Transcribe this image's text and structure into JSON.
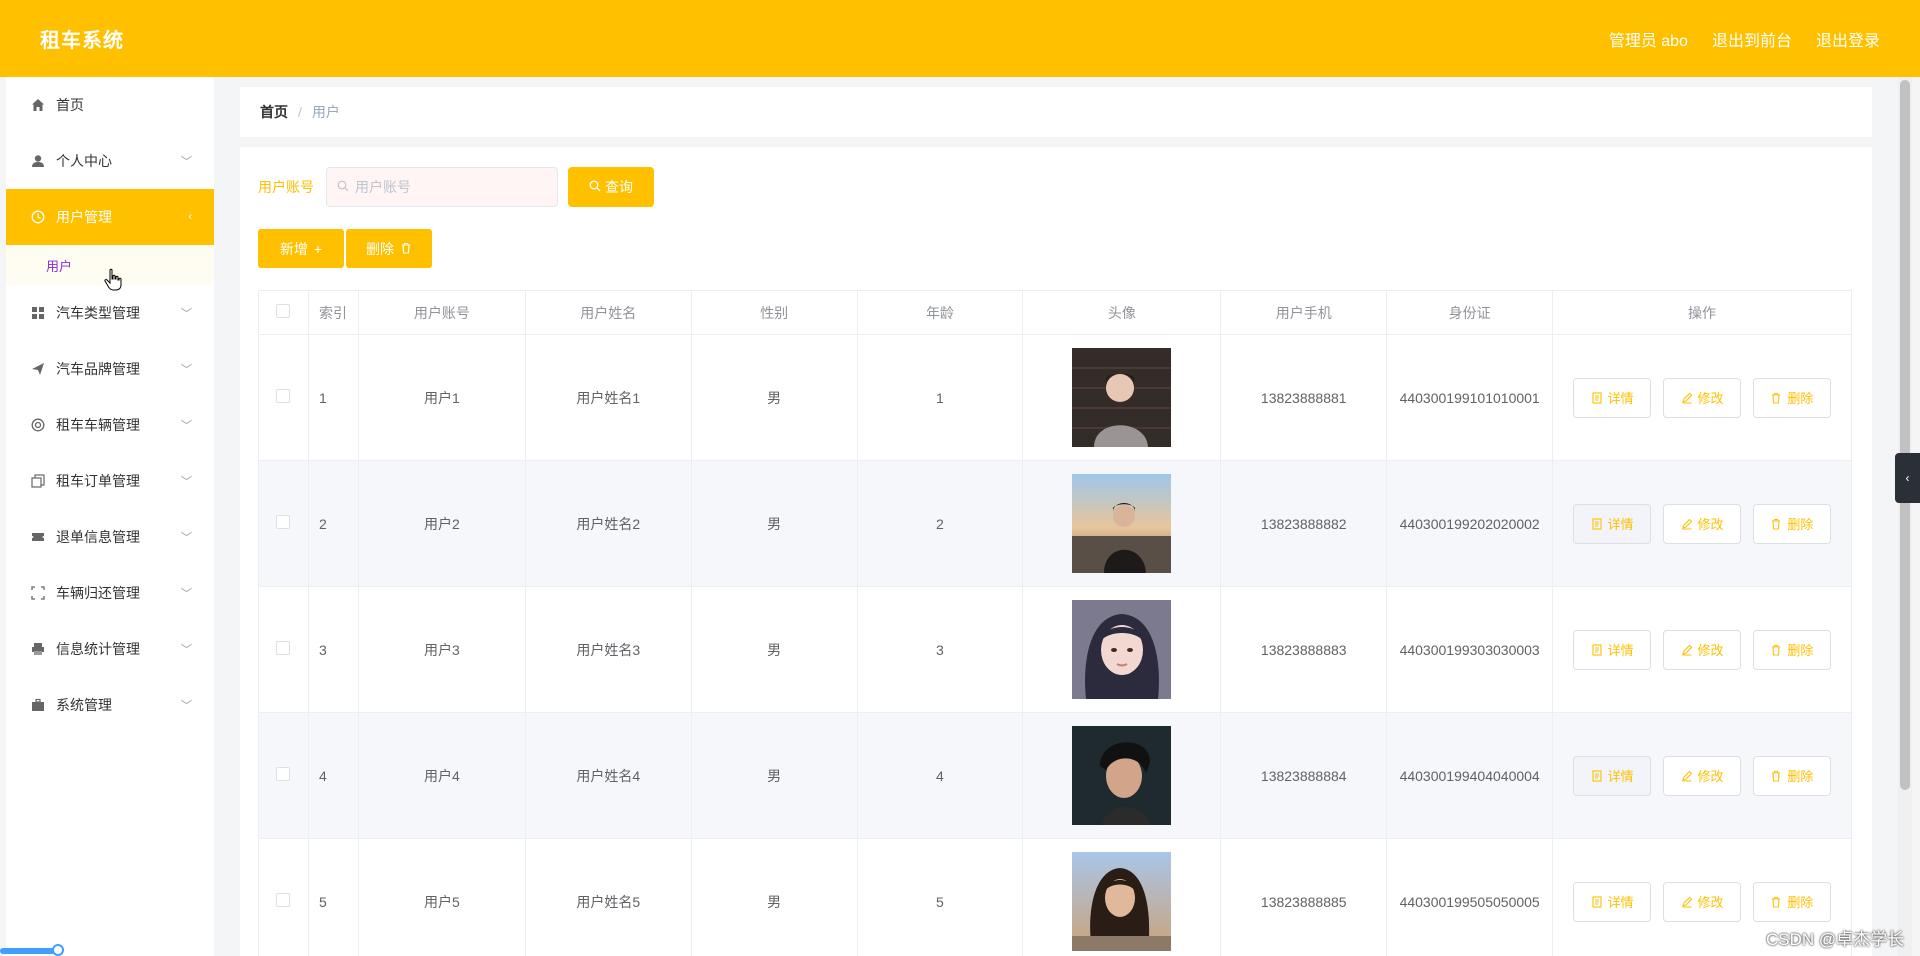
{
  "header": {
    "brand": "租车系统",
    "admin_label": "管理员 abo",
    "to_front": "退出到前台",
    "logout": "退出登录"
  },
  "sidebar": {
    "items": [
      {
        "label": "首页",
        "icon": "home-icon",
        "has_chevron": false
      },
      {
        "label": "个人中心",
        "icon": "user-icon",
        "has_chevron": true
      },
      {
        "label": "用户管理",
        "icon": "clock-icon",
        "has_chevron": true,
        "active": true
      },
      {
        "label": "汽车类型管理",
        "icon": "grid-icon",
        "has_chevron": true
      },
      {
        "label": "汽车品牌管理",
        "icon": "send-icon",
        "has_chevron": true
      },
      {
        "label": "租车车辆管理",
        "icon": "lifebuoy-icon",
        "has_chevron": true
      },
      {
        "label": "租车订单管理",
        "icon": "copy-icon",
        "has_chevron": true
      },
      {
        "label": "退单信息管理",
        "icon": "ticket-icon",
        "has_chevron": true
      },
      {
        "label": "车辆归还管理",
        "icon": "fullscreen-icon",
        "has_chevron": true
      },
      {
        "label": "信息统计管理",
        "icon": "printer-icon",
        "has_chevron": true
      },
      {
        "label": "系统管理",
        "icon": "briefcase-icon",
        "has_chevron": true
      }
    ],
    "submenu": {
      "label": "用户"
    }
  },
  "breadcrumb": {
    "home": "首页",
    "separator": "/",
    "current": "用户"
  },
  "search": {
    "label": "用户账号",
    "placeholder": "用户账号",
    "value": "",
    "query_button": "查询"
  },
  "actions": {
    "add": "新增",
    "delete": "删除"
  },
  "table": {
    "columns": [
      "索引",
      "用户账号",
      "用户姓名",
      "性别",
      "年龄",
      "头像",
      "用户手机",
      "身份证",
      "操作"
    ],
    "op_labels": {
      "detail": "详情",
      "edit": "修改",
      "delete": "删除"
    },
    "rows": [
      {
        "index": "1",
        "account": "用户1",
        "name": "用户姓名1",
        "gender": "男",
        "age": "1",
        "phone": "13823888881",
        "idcard": "440300199101010001"
      },
      {
        "index": "2",
        "account": "用户2",
        "name": "用户姓名2",
        "gender": "男",
        "age": "2",
        "phone": "13823888882",
        "idcard": "440300199202020002"
      },
      {
        "index": "3",
        "account": "用户3",
        "name": "用户姓名3",
        "gender": "男",
        "age": "3",
        "phone": "13823888883",
        "idcard": "440300199303030003"
      },
      {
        "index": "4",
        "account": "用户4",
        "name": "用户姓名4",
        "gender": "男",
        "age": "4",
        "phone": "13823888884",
        "idcard": "440300199404040004"
      },
      {
        "index": "5",
        "account": "用户5",
        "name": "用户姓名5",
        "gender": "男",
        "age": "5",
        "phone": "13823888885",
        "idcard": "440300199505050005"
      }
    ]
  },
  "watermark": "CSDN @卓杰学长",
  "colors": {
    "accent": "#ffc000",
    "submenu_text": "#8a2be2",
    "page_bg": "#f4f5f7"
  }
}
